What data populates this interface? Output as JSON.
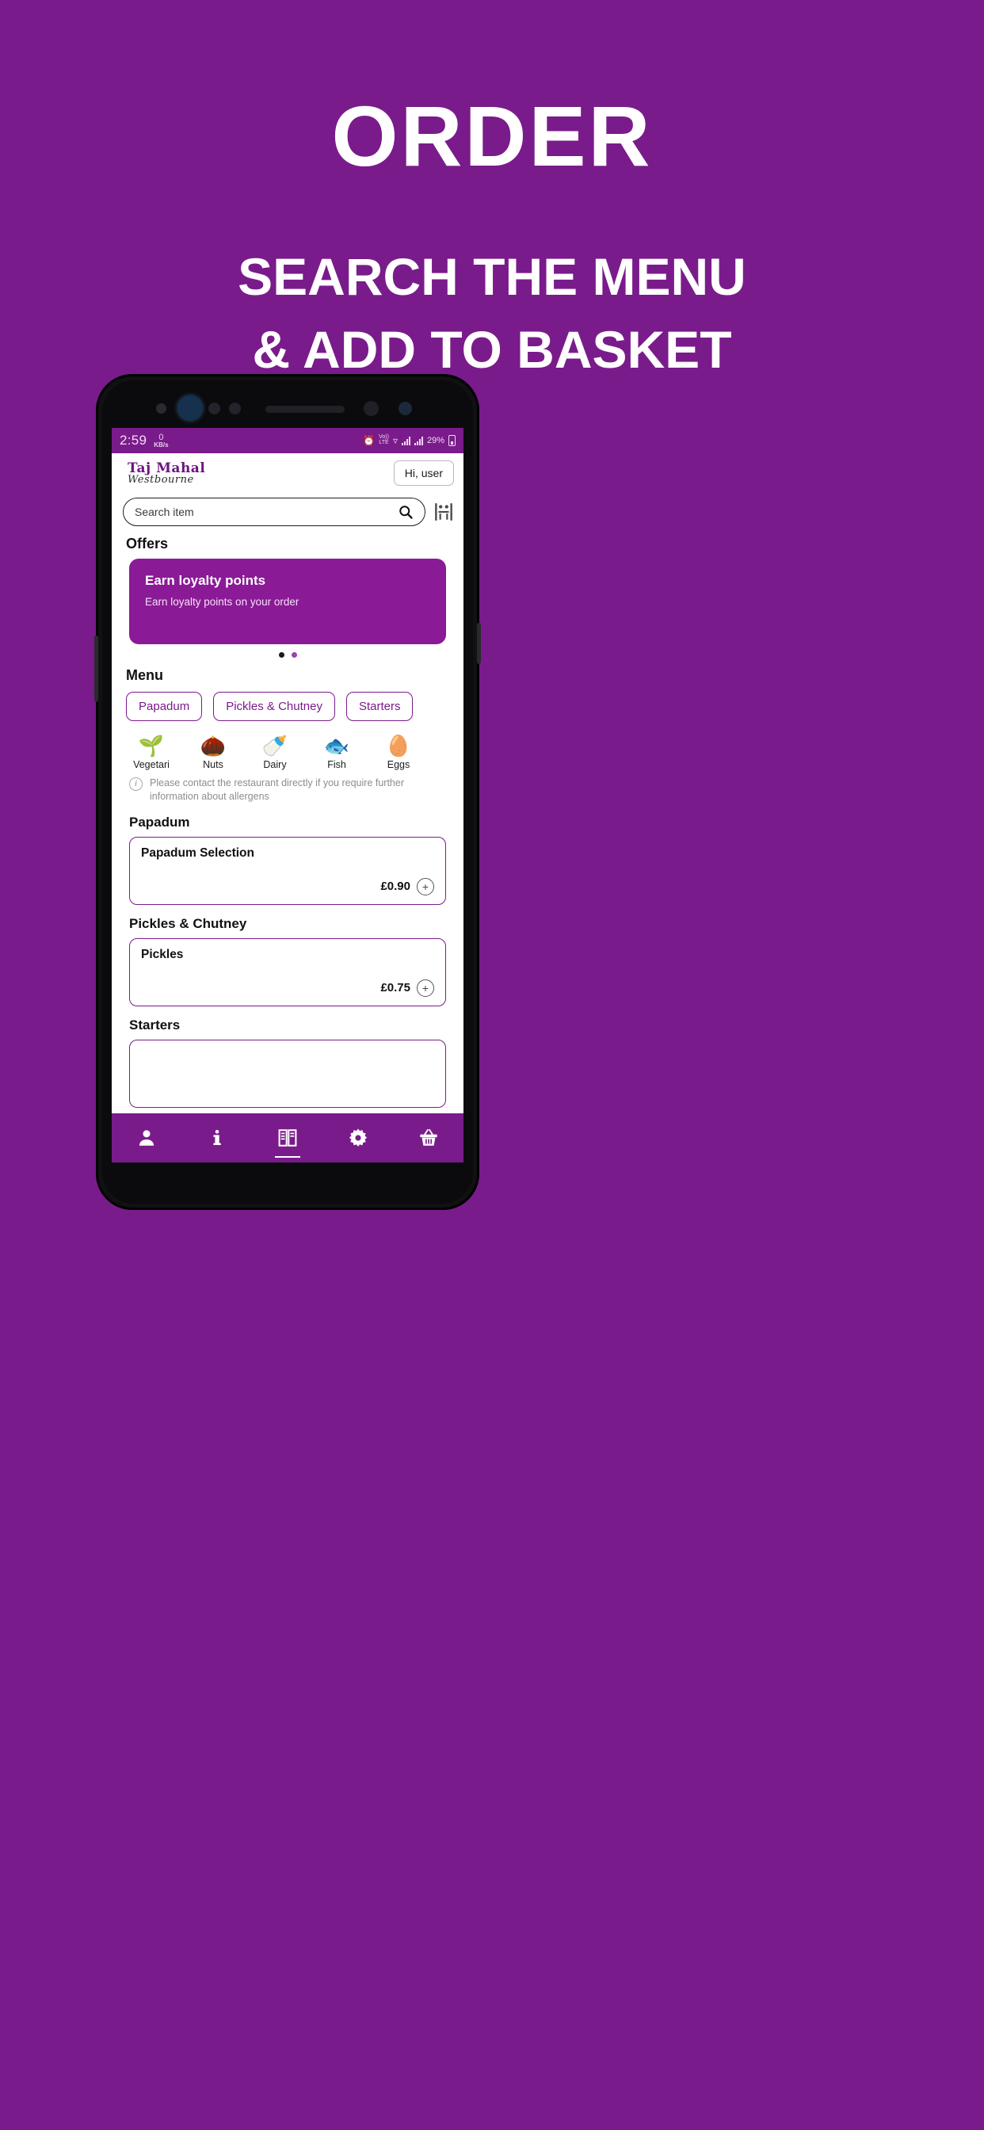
{
  "promo": {
    "title": "ORDER",
    "subtitle_line1": "SEARCH THE MENU",
    "subtitle_line2": "& ADD TO BASKET"
  },
  "colors": {
    "brand_purple": "#7A1B8B",
    "offer_card_purple": "#8A1A96",
    "page_background": "#7A1B8B",
    "screen_white": "#FFFFFF"
  },
  "status_bar": {
    "time": "2:59",
    "net_speed_value": "0",
    "net_speed_unit": "KB/s",
    "alarm_icon": "alarm-icon",
    "volte_label_top": "Vo))",
    "volte_label_bottom": "LTE",
    "wifi_icon": "wifi-icon",
    "signal_icon": "signal-bars-icon",
    "battery_percent": "29%",
    "battery_icon": "battery-icon"
  },
  "app_header": {
    "logo_line1": "Taj Mahal",
    "logo_line2": "Westbourne",
    "account_button": "Hi, user"
  },
  "search": {
    "placeholder": "Search item",
    "value": "",
    "search_icon": "search-icon",
    "table_booking_icon": "table-booking-icon"
  },
  "offers": {
    "section_title": "Offers",
    "card": {
      "title": "Earn loyalty points",
      "description": "Earn loyalty points on your order"
    },
    "carousel_dots": 2,
    "active_dot_index": 0
  },
  "menu": {
    "section_title": "Menu",
    "tabs": [
      {
        "label": "Papadum"
      },
      {
        "label": "Pickles & Chutney"
      },
      {
        "label": "Starters"
      }
    ],
    "allergens": [
      {
        "label": "Vegetari",
        "icon": "vegetarian-leaf-icon",
        "glyph": "🌱"
      },
      {
        "label": "Nuts",
        "icon": "nuts-icon",
        "glyph": "🌰"
      },
      {
        "label": "Dairy",
        "icon": "dairy-bottle-icon",
        "glyph": "🍼"
      },
      {
        "label": "Fish",
        "icon": "fish-icon",
        "glyph": "🐟"
      },
      {
        "label": "Eggs",
        "icon": "eggs-icon",
        "glyph": "🥚"
      }
    ],
    "allergen_note_line1": "Please contact the restaurant directly if you require further",
    "allergen_note_line2": "information about allergens",
    "allergen_note_icon": "info-icon",
    "groups": [
      {
        "title": "Papadum",
        "items": [
          {
            "name": "Papadum Selection",
            "price": "£0.90",
            "add_label": "+"
          }
        ]
      },
      {
        "title": "Pickles & Chutney",
        "items": [
          {
            "name": "Pickles",
            "price": "£0.75",
            "add_label": "+"
          }
        ]
      },
      {
        "title": "Starters",
        "items": []
      }
    ]
  },
  "bottom_nav": [
    {
      "icon": "account-person-icon",
      "active": false
    },
    {
      "icon": "info-i-icon",
      "active": false
    },
    {
      "icon": "menu-book-icon",
      "active": true
    },
    {
      "icon": "settings-gear-icon",
      "active": false
    },
    {
      "icon": "basket-icon",
      "active": false
    }
  ]
}
